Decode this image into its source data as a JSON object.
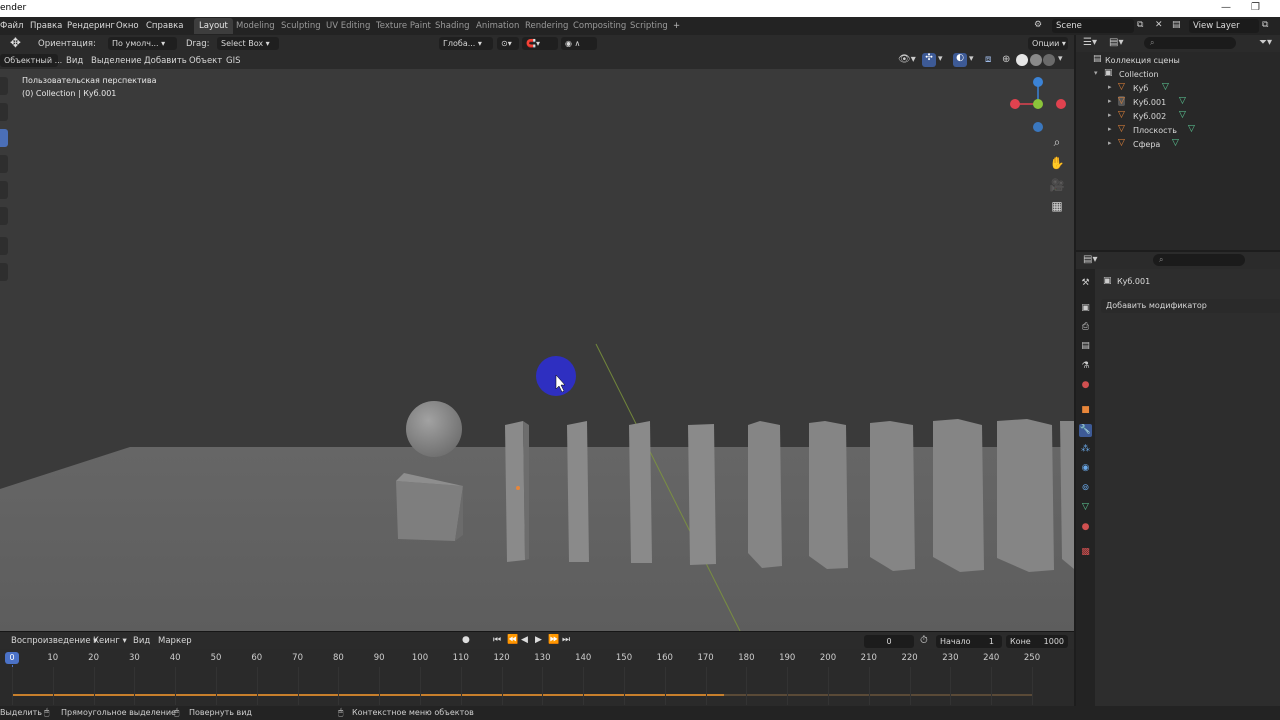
{
  "window": {
    "title": "ender"
  },
  "menu": {
    "items": [
      "Файл",
      "Правка",
      "Рендеринг",
      "Окно",
      "Справка"
    ]
  },
  "workspaces": {
    "tabs": [
      "Layout",
      "Modeling",
      "Sculpting",
      "UV Editing",
      "Texture Paint",
      "Shading",
      "Animation",
      "Rendering",
      "Compositing",
      "Scripting"
    ],
    "active": "Layout",
    "add_label": "+"
  },
  "scene": {
    "scene_name": "Scene",
    "view_layer": "View Layer"
  },
  "tool_header": {
    "orientation_label": "Ориентация:",
    "orientation_value": "По умолч...",
    "drag_label": "Drag:",
    "drag_value": "Select Box",
    "transform_value": "Глоба...",
    "options_label": "Опции"
  },
  "viewport_header": {
    "mode": "Объектный ...",
    "menus": [
      "Вид",
      "Выделение",
      "Добавить",
      "Объект",
      "GIS"
    ]
  },
  "viewport": {
    "perspective_label": "Пользовательская перспектива",
    "collection_label": "(0) Collection | Куб.001",
    "gizmo": {
      "x_color": "#e0424f",
      "y_color": "#8bc43a",
      "z_color": "#3b83d6"
    }
  },
  "timeline": {
    "menus": [
      "Воспроизведение",
      "Кеинг",
      "Вид",
      "Маркер"
    ],
    "current_frame": "0",
    "start_label": "Начало",
    "start_value": "1",
    "end_label": "Коне",
    "end_value": "1000",
    "ticks": [
      "0",
      "10",
      "20",
      "30",
      "40",
      "50",
      "60",
      "70",
      "80",
      "90",
      "100",
      "110",
      "120",
      "130",
      "140",
      "150",
      "160",
      "170",
      "180",
      "190",
      "200",
      "210",
      "220",
      "230",
      "240",
      "250"
    ]
  },
  "status_bar": {
    "items": [
      "Выделить",
      "Прямоугольное выделение",
      "Повернуть вид",
      "Контекстное меню объектов"
    ]
  },
  "outliner": {
    "title": "Коллекция сцены",
    "collection": "Collection",
    "objects": [
      "Куб",
      "Куб.001",
      "Куб.002",
      "Плоскость",
      "Сфера"
    ]
  },
  "properties": {
    "object_name": "Куб.001",
    "add_modifier_label": "Добавить модификатор"
  },
  "colors": {
    "accent_blue": "#4b72c7",
    "object_orange": "#e8863a",
    "mesh_green": "#5fcf9a",
    "cursor_circle": "#2e2fd0"
  }
}
